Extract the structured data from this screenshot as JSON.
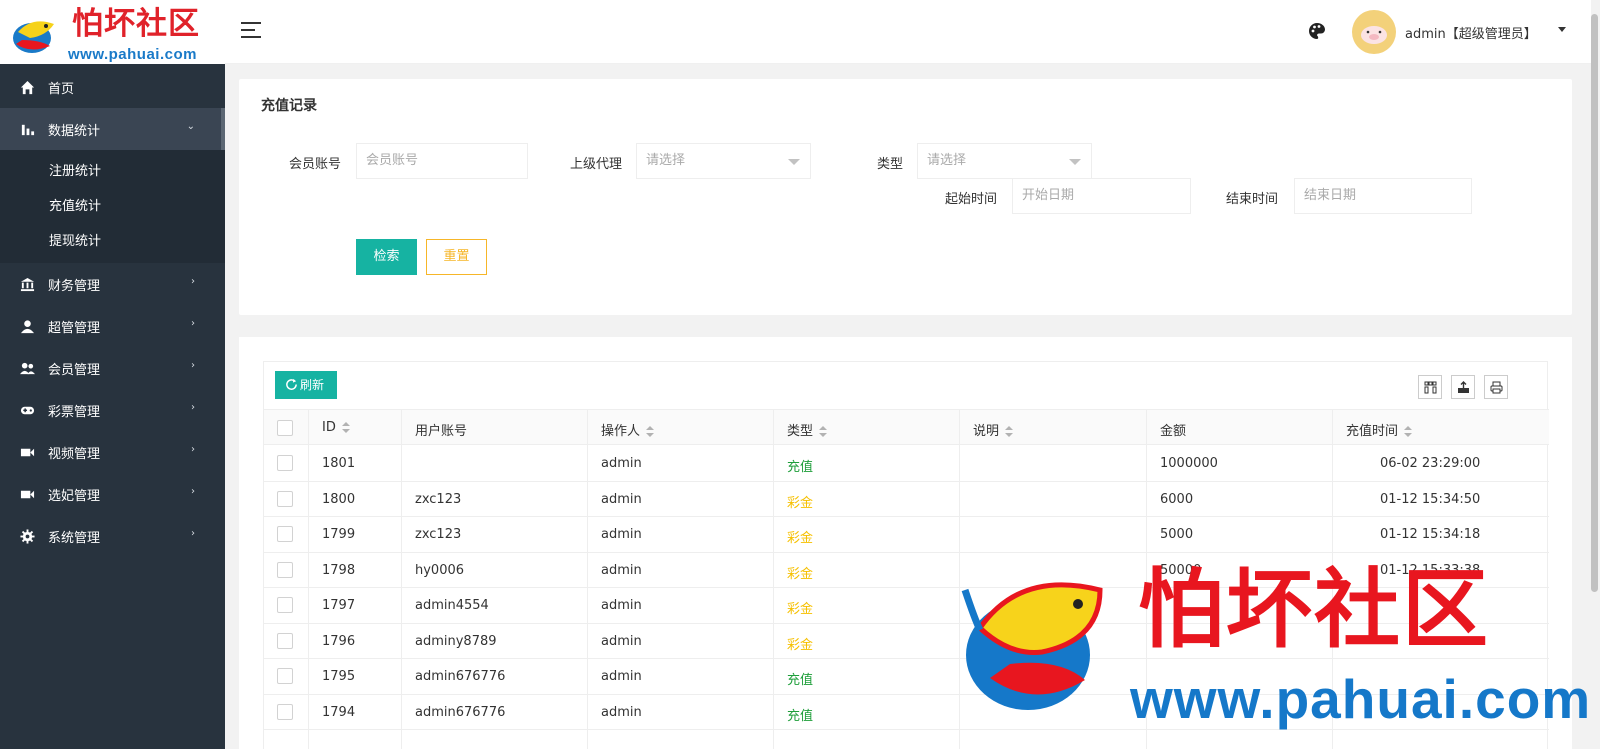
{
  "logo": {
    "title": "怕坏社区",
    "url": "www.pahuai.com"
  },
  "sidebar": {
    "items": [
      {
        "label": "首页",
        "icon": "home-icon"
      },
      {
        "label": "数据统计",
        "icon": "bar-chart-icon",
        "expanded": true,
        "children": [
          {
            "label": "注册统计"
          },
          {
            "label": "充值统计"
          },
          {
            "label": "提现统计"
          }
        ]
      },
      {
        "label": "财务管理",
        "icon": "bank-icon"
      },
      {
        "label": "超管管理",
        "icon": "user-icon"
      },
      {
        "label": "会员管理",
        "icon": "users-icon"
      },
      {
        "label": "彩票管理",
        "icon": "gamepad-icon"
      },
      {
        "label": "视频管理",
        "icon": "video-icon"
      },
      {
        "label": "选妃管理",
        "icon": "video-icon"
      },
      {
        "label": "系统管理",
        "icon": "gear-icon"
      }
    ]
  },
  "header": {
    "username": "admin【超级管理员】",
    "icons": [
      "menu-icon",
      "palette-icon",
      "avatar"
    ]
  },
  "search": {
    "title": "充值记录",
    "member_label": "会员账号",
    "member_placeholder": "会员账号",
    "agent_label": "上级代理",
    "agent_placeholder": "请选择",
    "type_label": "类型",
    "type_placeholder": "请选择",
    "start_label": "起始时间",
    "start_placeholder": "开始日期",
    "end_label": "结束时间",
    "end_placeholder": "结束日期",
    "search_button": "检索",
    "reset_button": "重置"
  },
  "table": {
    "refresh_label": "刷新",
    "columns": [
      "ID",
      "用户账号",
      "操作人",
      "类型",
      "说明",
      "金额",
      "充值时间"
    ],
    "rows": [
      {
        "id": "1801",
        "user": "",
        "operator": "admin",
        "type": "充值",
        "desc": "",
        "amount": "1000000",
        "time": "06-02 23:29:00"
      },
      {
        "id": "1800",
        "user": "zxc123",
        "operator": "admin",
        "type": "彩金",
        "desc": "",
        "amount": "6000",
        "time": "01-12 15:34:50"
      },
      {
        "id": "1799",
        "user": "zxc123",
        "operator": "admin",
        "type": "彩金",
        "desc": "",
        "amount": "5000",
        "time": "01-12 15:34:18"
      },
      {
        "id": "1798",
        "user": "hy0006",
        "operator": "admin",
        "type": "彩金",
        "desc": "",
        "amount": "50000",
        "time": "01-12 15:33:38"
      },
      {
        "id": "1797",
        "user": "admin4554",
        "operator": "admin",
        "type": "彩金",
        "desc": "",
        "amount": "",
        "time": ""
      },
      {
        "id": "1796",
        "user": "adminy8789",
        "operator": "admin",
        "type": "彩金",
        "desc": "",
        "amount": "",
        "time": ""
      },
      {
        "id": "1795",
        "user": "admin676776",
        "operator": "admin",
        "type": "充值",
        "desc": "",
        "amount": "",
        "time": ""
      },
      {
        "id": "1794",
        "user": "admin676776",
        "operator": "admin",
        "type": "充值",
        "desc": "",
        "amount": "",
        "time": ""
      }
    ]
  },
  "watermark": {
    "title": "怕坏社区",
    "url": "www.pahuai.com"
  },
  "colors": {
    "sidebar": "#28333e",
    "primary": "#16b3a2",
    "warning": "#f6b629",
    "green": "#1e9e3a",
    "yellow": "#f6c000"
  }
}
